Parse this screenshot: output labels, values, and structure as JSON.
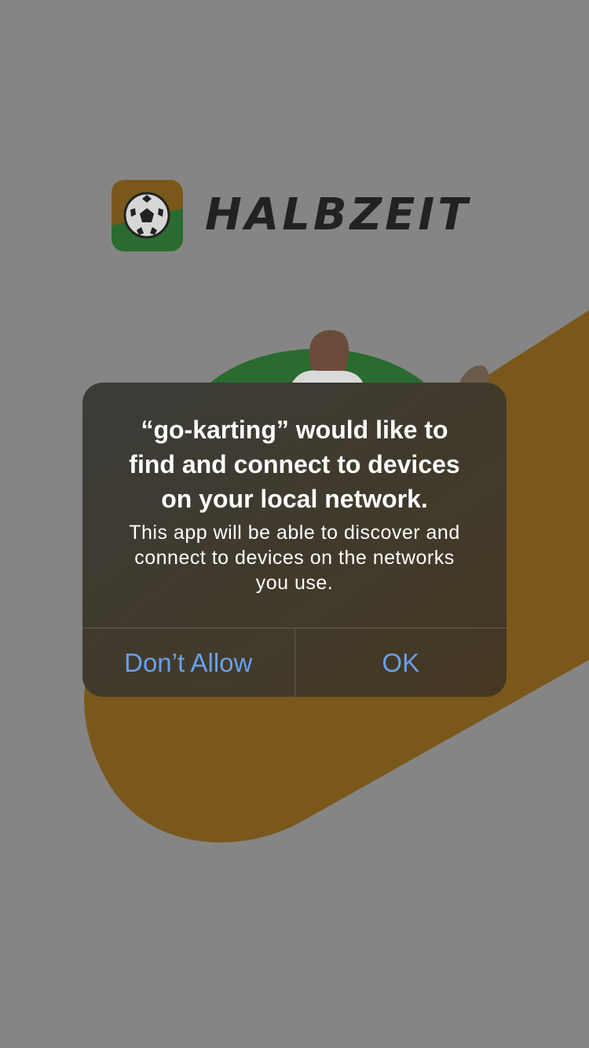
{
  "app": {
    "brand": "HALBZEIT"
  },
  "alert": {
    "title": "“go-karting” would like to\nfind and connect to devices\non your local network.",
    "message": "This app will be able to discover and\nconnect to devices on the networks\nyou use.",
    "buttons": {
      "deny_label": "Don’t Allow",
      "ok_label": "OK"
    }
  },
  "colors": {
    "dim_overlay": "#858585",
    "accent_gold": "#7a581c",
    "accent_green": "#2a6b2f",
    "button_blue": "#6aa0ea",
    "alert_bg": "#413a2c"
  },
  "icons": {
    "logo": "soccer-ball-icon"
  }
}
